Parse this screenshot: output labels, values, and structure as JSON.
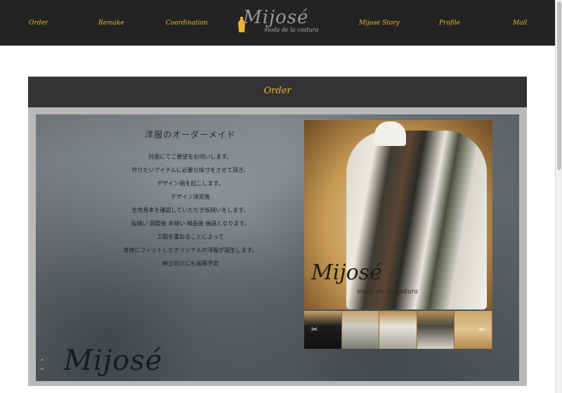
{
  "nav": {
    "items": [
      "Order",
      "Remake",
      "Coordination",
      "Mijose Story",
      "Profile",
      "Mail"
    ],
    "logo_word": "Mijosé",
    "logo_tagline": "moda de la costura"
  },
  "section": {
    "title": "Order",
    "heading": "洋服のオーダーメイド",
    "lines": [
      "対面にてご要望をお伺いします。",
      "作りたいアイテムに必要な採寸をさせて頂き、",
      "デザイン画を起こします。",
      "デザイン決定後",
      "生地見本を確認していただき仮縫いをします。",
      "仮縫い 調整後 本縫い 検品後 納品となります。",
      "工程を重ねることによって",
      "身体にフィットしたオリジナルの洋服が誕生します。",
      "紳士向けにも展開予定"
    ],
    "panel_logo": "Mijosé",
    "photo_logo": "Mijosé",
    "photo_tagline": "moda de la costura",
    "up_arrows": [
      "^",
      "^"
    ]
  },
  "gallery": {
    "thumbnail_count": 5,
    "prev_icon": "scissors-icon",
    "next_icon": "scissors-icon"
  },
  "colors": {
    "accent": "#e9b52a",
    "nav_bg": "#232323",
    "section_header_bg": "#333333"
  }
}
